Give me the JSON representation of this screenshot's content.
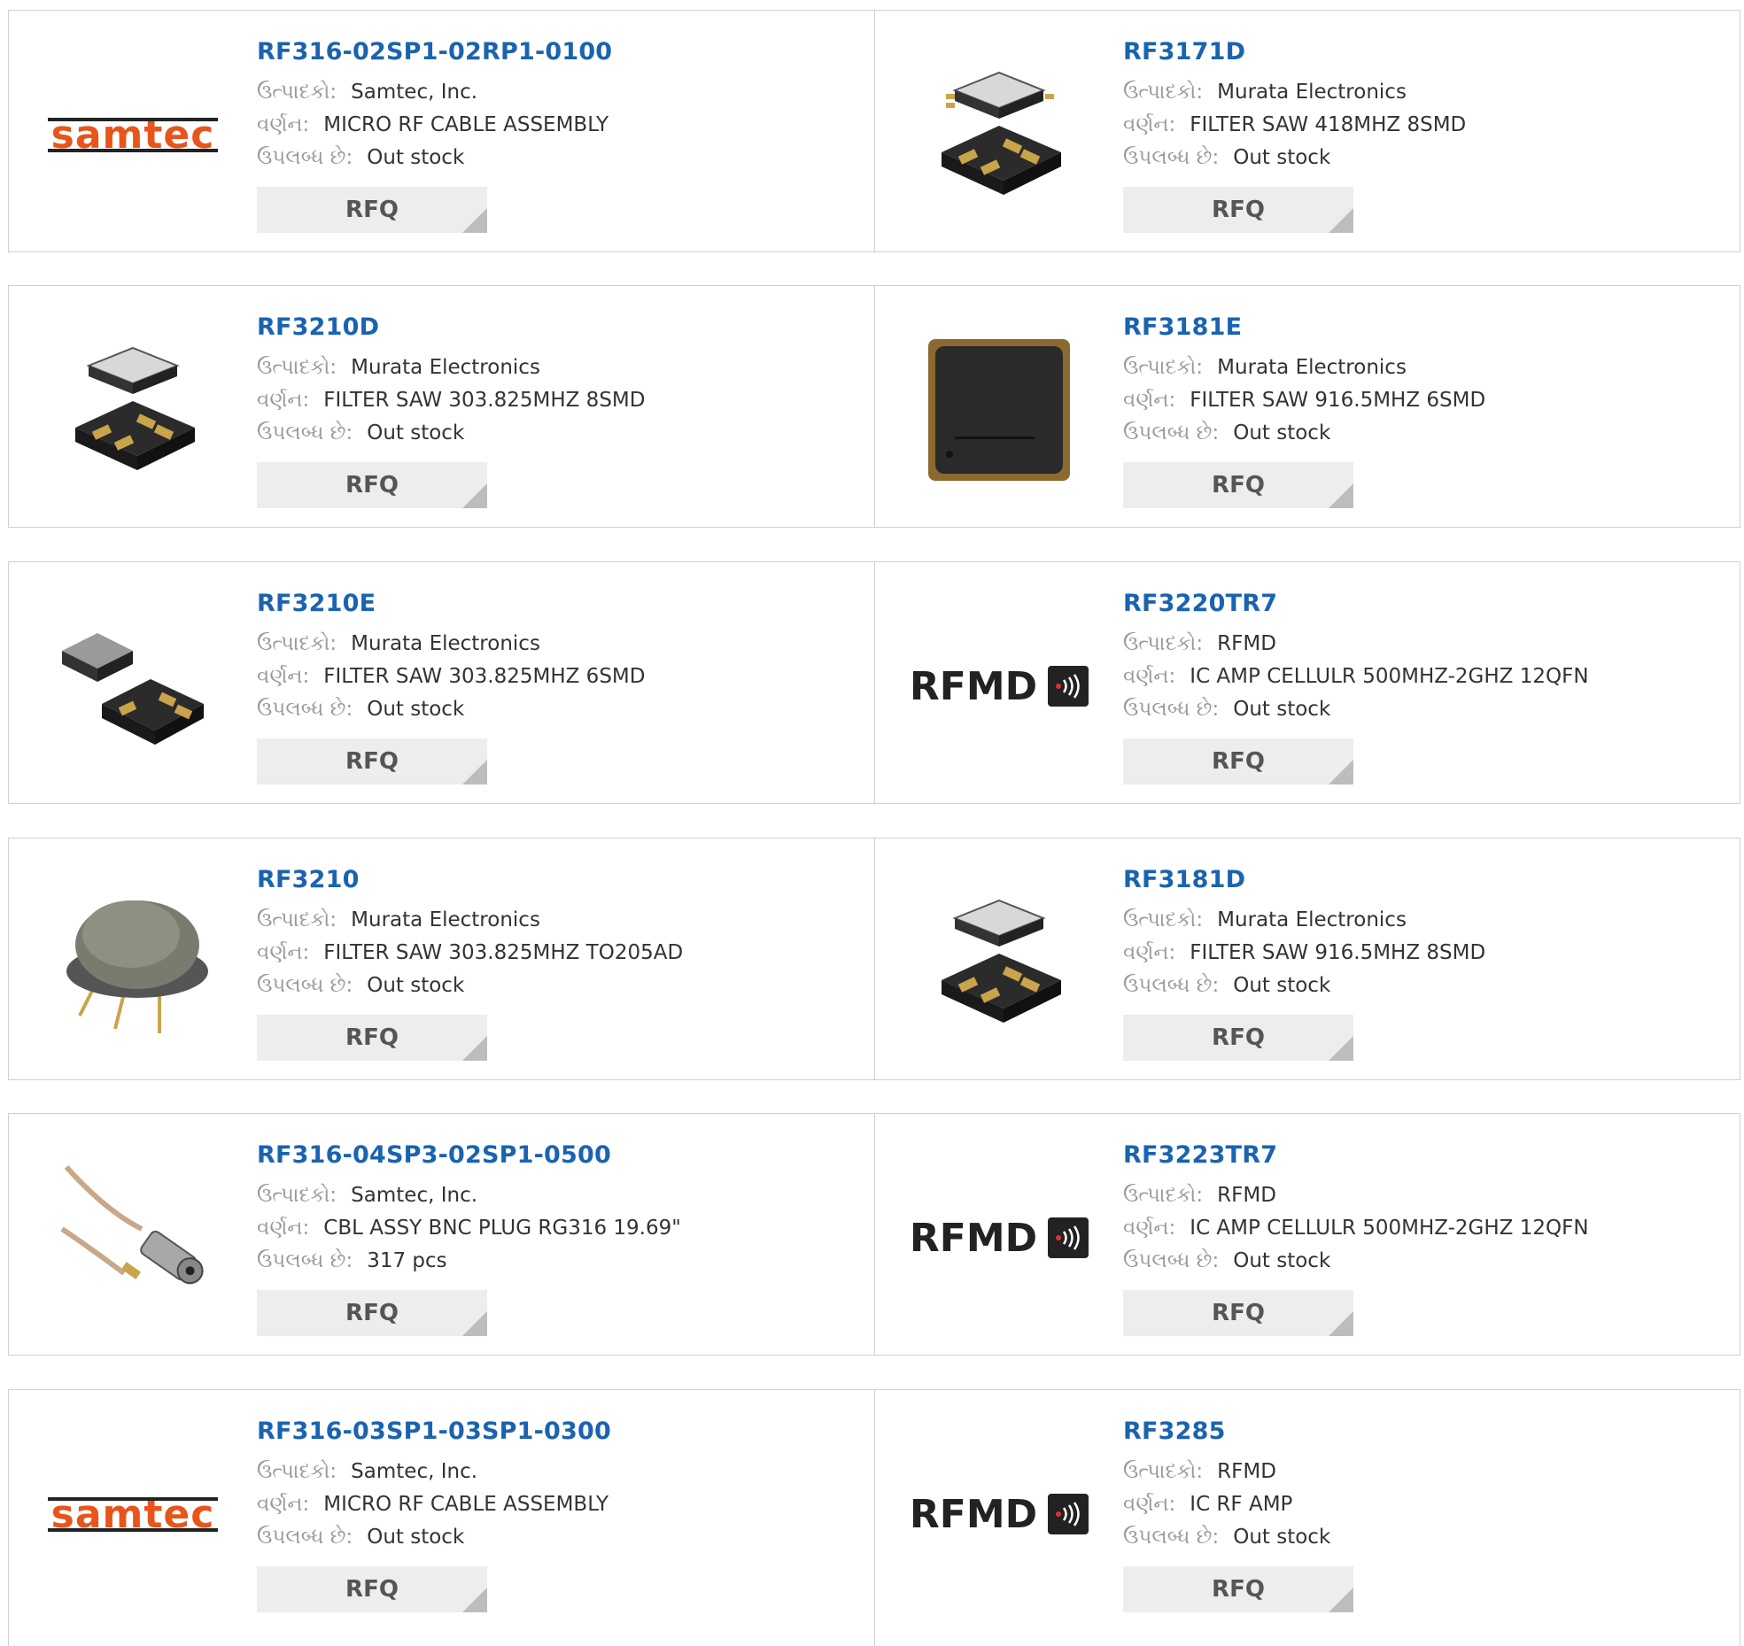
{
  "labels": {
    "manufacturer": "ઉત્પાદકો:",
    "description": "વર્ણન:",
    "availability": "ઉપલબ્ધ છે:",
    "rfq": "RFQ"
  },
  "products": [
    {
      "pn": "RF316-02SP1-02RP1-0100",
      "manufacturer": "Samtec, Inc.",
      "description": "MICRO RF CABLE ASSEMBLY",
      "availability": "Out stock",
      "image": "samtec-logo"
    },
    {
      "pn": "RF3171D",
      "manufacturer": "Murata Electronics",
      "description": "FILTER SAW 418MHZ 8SMD",
      "availability": "Out stock",
      "image": "smd-8pin-package"
    },
    {
      "pn": "RF3210D",
      "manufacturer": "Murata Electronics",
      "description": "FILTER SAW 303.825MHZ 8SMD",
      "availability": "Out stock",
      "image": "smd-8pin-package"
    },
    {
      "pn": "RF3181E",
      "manufacturer": "Murata Electronics",
      "description": "FILTER SAW 916.5MHZ 6SMD",
      "availability": "Out stock",
      "image": "smd-square-package"
    },
    {
      "pn": "RF3210E",
      "manufacturer": "Murata Electronics",
      "description": "FILTER SAW 303.825MHZ 6SMD",
      "availability": "Out stock",
      "image": "smd-6pin-package"
    },
    {
      "pn": "RF3220TR7",
      "manufacturer": "RFMD",
      "description": "IC AMP CELLULR 500MHZ-2GHZ 12QFN",
      "availability": "Out stock",
      "image": "rfmd-logo"
    },
    {
      "pn": "RF3210",
      "manufacturer": "Murata Electronics",
      "description": "FILTER SAW 303.825MHZ TO205AD",
      "availability": "Out stock",
      "image": "to205-can-package"
    },
    {
      "pn": "RF3181D",
      "manufacturer": "Murata Electronics",
      "description": "FILTER SAW 916.5MHZ 8SMD",
      "availability": "Out stock",
      "image": "smd-8pin-package"
    },
    {
      "pn": "RF316-04SP3-02SP1-0500",
      "manufacturer": "Samtec, Inc.",
      "description": "CBL ASSY BNC PLUG RG316 19.69\"",
      "availability": "317 pcs",
      "image": "bnc-cable"
    },
    {
      "pn": "RF3223TR7",
      "manufacturer": "RFMD",
      "description": "IC AMP CELLULR 500MHZ-2GHZ 12QFN",
      "availability": "Out stock",
      "image": "rfmd-logo"
    },
    {
      "pn": "RF316-03SP1-03SP1-0300",
      "manufacturer": "Samtec, Inc.",
      "description": "MICRO RF CABLE ASSEMBLY",
      "availability": "Out stock",
      "image": "samtec-logo"
    },
    {
      "pn": "RF3285",
      "manufacturer": "RFMD",
      "description": "IC RF AMP",
      "availability": "Out stock",
      "image": "rfmd-logo"
    }
  ],
  "logos": {
    "samtec": "samtec",
    "rfmd": "RFMD"
  },
  "colors": {
    "link": "#1a63b0",
    "samtec_orange": "#e8551b",
    "rfq_bg": "#ededed",
    "border": "#d0d0d0"
  }
}
